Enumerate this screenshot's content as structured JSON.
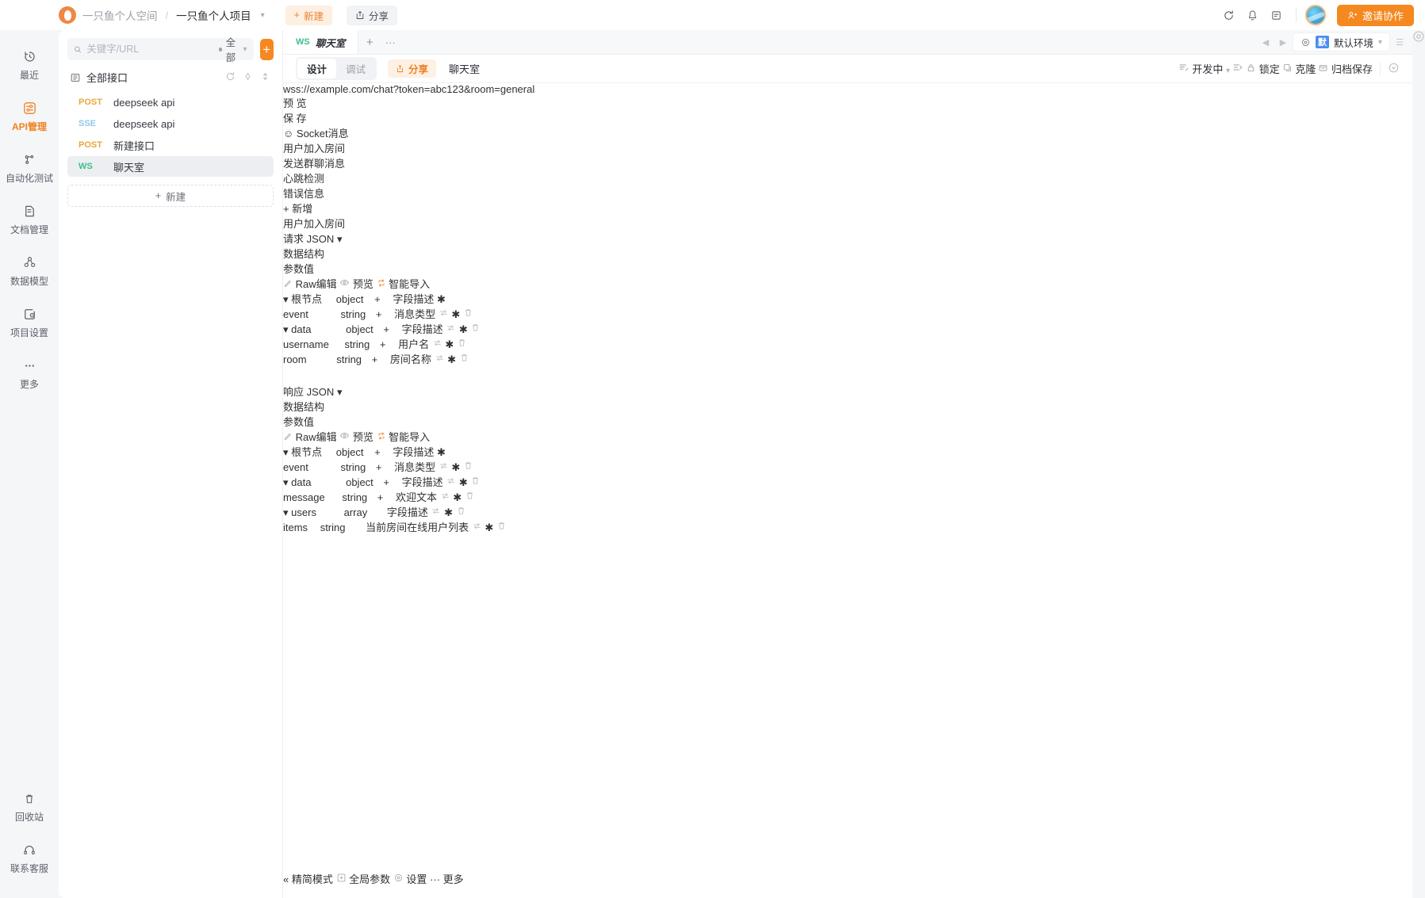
{
  "topbar": {
    "workspace": "一只鱼个人空间",
    "separator": "/",
    "project": "一只鱼个人项目",
    "create_label": "新建",
    "share_label": "分享",
    "invite_label": "邀请协作",
    "icons": [
      "sync-icon",
      "bell-icon",
      "notes-icon",
      "avatar",
      "invite-user-icon"
    ]
  },
  "rail": {
    "items": [
      {
        "label": "最近",
        "icon": "clock-history-icon",
        "active": false
      },
      {
        "label": "API管理",
        "icon": "api-icon",
        "active": true
      },
      {
        "label": "自动化测试",
        "icon": "automation-icon",
        "active": false
      },
      {
        "label": "文档管理",
        "icon": "document-icon",
        "active": false
      },
      {
        "label": "数据模型",
        "icon": "data-model-icon",
        "active": false
      },
      {
        "label": "项目设置",
        "icon": "project-settings-icon",
        "active": false
      },
      {
        "label": "更多",
        "icon": "more-dots-icon",
        "active": false
      }
    ],
    "bottom": [
      {
        "label": "回收站",
        "icon": "trash-icon"
      },
      {
        "label": "联系客服",
        "icon": "headset-icon"
      }
    ]
  },
  "apilist": {
    "search_placeholder": "关键字/URL",
    "search_value": "",
    "filter_label": "全部",
    "add_tooltip": "+",
    "group_label": "全部接口",
    "group_actions": [
      "refresh-icon",
      "locate-icon",
      "sort-icon"
    ],
    "items": [
      {
        "method": "POST",
        "name": "deepseek api",
        "selected": false
      },
      {
        "method": "SSE",
        "name": "deepseek api",
        "selected": false
      },
      {
        "method": "POST",
        "name": "新建接口",
        "selected": false
      },
      {
        "method": "WS",
        "name": "聊天室",
        "selected": true
      }
    ],
    "new_label": "新建"
  },
  "doctabs": {
    "open": [
      {
        "tag": "WS",
        "title": "聊天室"
      }
    ],
    "add_label": "+",
    "more_label": "···",
    "env_label": "默认环境",
    "env_badge": "默",
    "menu_icon": "hamburger-icon"
  },
  "subbar": {
    "segments": [
      {
        "label": "设计",
        "active": true
      },
      {
        "label": "调试",
        "active": false
      }
    ],
    "share_label": "分享",
    "title": "聊天室",
    "status_label": "开发中",
    "actions": [
      {
        "label": "锁定",
        "icon": "lock-icon"
      },
      {
        "label": "克隆",
        "icon": "clone-icon"
      },
      {
        "label": "归档保存",
        "icon": "archive-icon"
      }
    ]
  },
  "url": {
    "value": "wss://example.com/chat?token=abc123&room=general",
    "preview_label": "预 览",
    "save_label": "保 存"
  },
  "socket": {
    "section_title": "Socket消息",
    "section_icon": "socket-icon",
    "tabs": [
      {
        "label": "用户加入房间",
        "active": true
      },
      {
        "label": "发送群聊消息",
        "active": false
      },
      {
        "label": "心跳检测",
        "active": false
      },
      {
        "label": "错误信息",
        "active": false
      }
    ],
    "add_label": "新增",
    "message_name": "用户加入房间"
  },
  "request": {
    "label": "请求",
    "format": "JSON",
    "segments": [
      {
        "label": "数据结构",
        "active": true
      },
      {
        "label": "参数值",
        "active": false
      }
    ],
    "actions": [
      {
        "label": "Raw编辑",
        "icon": "pencil-icon",
        "hot": false
      },
      {
        "label": "预览",
        "icon": "eye-icon",
        "hot": false
      },
      {
        "label": "智能导入",
        "icon": "import-icon",
        "hot": true
      }
    ],
    "tree": [
      {
        "key": "根节点",
        "type": "object",
        "desc": "字段描述",
        "desc_placeholder": true,
        "depth": 0,
        "caret": "down",
        "root": true,
        "has_sync": false,
        "has_delete": false
      },
      {
        "key": "event",
        "type": "string",
        "desc": "消息类型",
        "desc_placeholder": false,
        "depth": 1,
        "caret": "none",
        "root": false,
        "has_sync": true,
        "has_delete": true
      },
      {
        "key": "data",
        "type": "object",
        "desc": "字段描述",
        "desc_placeholder": true,
        "depth": 1,
        "caret": "down",
        "root": false,
        "has_sync": true,
        "has_delete": true
      },
      {
        "key": "username",
        "type": "string",
        "desc": "用户名",
        "desc_placeholder": false,
        "depth": 2,
        "caret": "none",
        "root": false,
        "has_sync": true,
        "has_delete": true
      },
      {
        "key": "room",
        "type": "string",
        "desc": "房间名称",
        "desc_placeholder": false,
        "depth": 2,
        "caret": "none",
        "root": false,
        "has_sync": true,
        "has_delete": true
      }
    ]
  },
  "response": {
    "label": "响应",
    "format": "JSON",
    "segments": [
      {
        "label": "数据结构",
        "active": true
      },
      {
        "label": "参数值",
        "active": false
      }
    ],
    "actions": [
      {
        "label": "Raw编辑",
        "icon": "pencil-icon",
        "hot": false
      },
      {
        "label": "预览",
        "icon": "eye-icon",
        "hot": false
      },
      {
        "label": "智能导入",
        "icon": "import-icon",
        "hot": true
      }
    ],
    "tree": [
      {
        "key": "根节点",
        "type": "object",
        "desc": "字段描述",
        "desc_placeholder": true,
        "depth": 0,
        "caret": "down",
        "root": true,
        "has_sync": false,
        "has_delete": false
      },
      {
        "key": "event",
        "type": "string",
        "desc": "消息类型",
        "desc_placeholder": false,
        "depth": 1,
        "caret": "none",
        "root": false,
        "has_sync": true,
        "has_delete": true
      },
      {
        "key": "data",
        "type": "object",
        "desc": "字段描述",
        "desc_placeholder": true,
        "depth": 1,
        "caret": "down",
        "root": false,
        "has_sync": true,
        "has_delete": true
      },
      {
        "key": "message",
        "type": "string",
        "desc": "欢迎文本",
        "desc_placeholder": false,
        "depth": 2,
        "caret": "none",
        "root": false,
        "has_sync": true,
        "has_delete": true
      },
      {
        "key": "users",
        "type": "array",
        "desc": "字段描述",
        "desc_placeholder": true,
        "depth": 2,
        "caret": "down",
        "root": false,
        "has_sync": true,
        "has_delete": true
      },
      {
        "key": "items",
        "type": "string",
        "desc": "当前房间在线用户列表",
        "desc_placeholder": false,
        "depth": 3,
        "caret": "none",
        "root": false,
        "items_key": true,
        "has_sync": true,
        "has_delete": true,
        "no_add": true
      }
    ]
  },
  "footer": {
    "compact_label": "精简模式",
    "right": [
      {
        "label": "全局参数",
        "icon": "global-params-icon"
      },
      {
        "label": "设置",
        "icon": "gear-icon"
      },
      {
        "label": "更多",
        "icon": "more-dots-icon"
      }
    ]
  },
  "colors": {
    "brand": "#f5881f",
    "accent_hot": "#ef8024",
    "type_object": "#4a90e2",
    "type_string": "#3dbd80",
    "method_post": "#eaa73c",
    "method_sse": "#8fc7ec",
    "method_ws": "#3dc08a",
    "status_dev": "#3a7ef0"
  }
}
